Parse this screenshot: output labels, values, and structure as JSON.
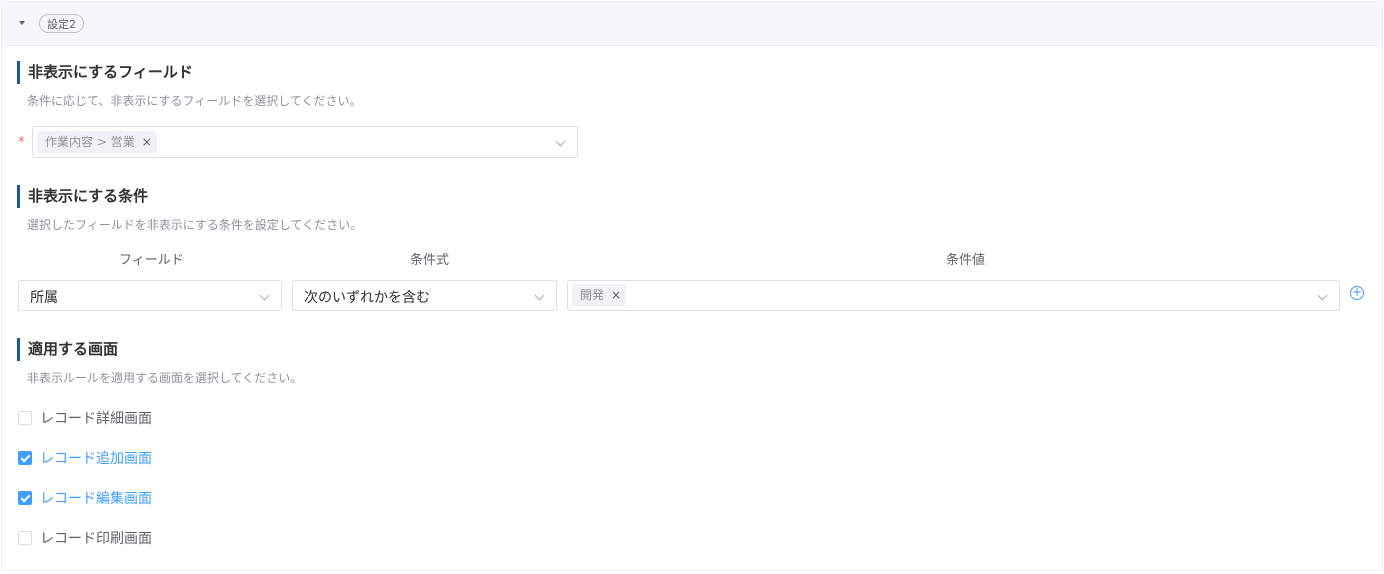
{
  "panel": {
    "tag_label": "設定2"
  },
  "hidden_fields": {
    "title": "非表示にするフィールド",
    "description": "条件に応じて、非表示にするフィールドを選択してください。",
    "required_mark": "*",
    "selected_chip": "作業内容 > 営業",
    "chip_remove": "×"
  },
  "conditions": {
    "title": "非表示にする条件",
    "description": "選択したフィールドを非表示にする条件を設定してください。",
    "columns": {
      "field": "フィールド",
      "operator": "条件式",
      "value": "条件値"
    },
    "row": {
      "field": "所属",
      "operator": "次のいずれかを含む",
      "value_chip": "開発",
      "chip_remove": "×"
    },
    "add_symbol": "+"
  },
  "screens": {
    "title": "適用する画面",
    "description": "非表示ルールを適用する画面を選択してください。",
    "options": [
      {
        "label": "レコード詳細画面",
        "checked": false
      },
      {
        "label": "レコード追加画面",
        "checked": true
      },
      {
        "label": "レコード編集画面",
        "checked": true
      },
      {
        "label": "レコード印刷画面",
        "checked": false
      }
    ]
  },
  "colors": {
    "accent": "#409eff",
    "section_bar": "#1a5a96",
    "required": "#f56c6c"
  }
}
